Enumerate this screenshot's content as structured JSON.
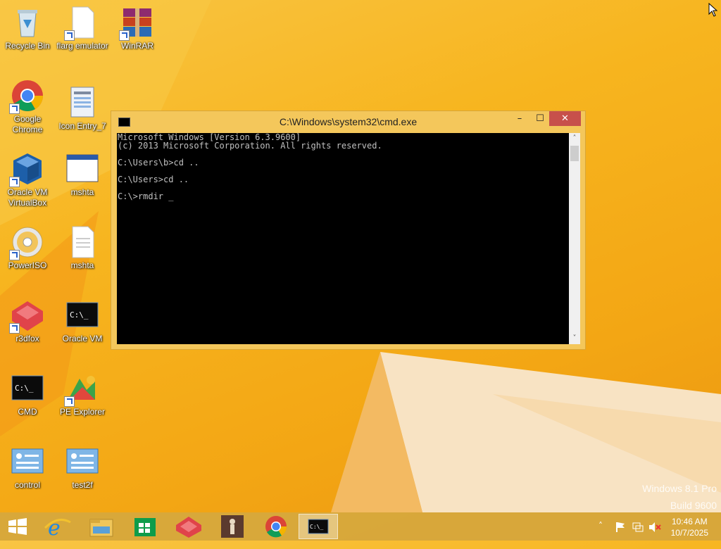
{
  "desktop": {
    "icons": [
      {
        "label": "Recycle Bin"
      },
      {
        "label": "flarg emulator"
      },
      {
        "label": "WinRAR"
      },
      {
        "label": "Google Chrome"
      },
      {
        "label": "Icon Entry_7"
      },
      {
        "label": "Oracle VM VirtualBox"
      },
      {
        "label": "mshta"
      },
      {
        "label": "PowerISO"
      },
      {
        "label": "mshta"
      },
      {
        "label": "r3dfox"
      },
      {
        "label": "Oracle VM"
      },
      {
        "label": "CMD"
      },
      {
        "label": "PE Explorer"
      },
      {
        "label": "control"
      },
      {
        "label": "test2f"
      }
    ],
    "watermark": {
      "line1": "Windows 8.1 Pro",
      "line2": "Build 9600"
    }
  },
  "cmd_window": {
    "title": "C:\\Windows\\system32\\cmd.exe",
    "min_label": "–",
    "max_label": "☐",
    "close_label": "✕",
    "console_text": "Microsoft Windows [Version 6.3.9600]\n(c) 2013 Microsoft Corporation. All rights reserved.\n\nC:\\Users\\b>cd ..\n\nC:\\Users>cd ..\n\nC:\\>rmdir _",
    "scroll_up": "˄",
    "scroll_down": "˅"
  },
  "taskbar": {
    "items": [
      {
        "name": "start",
        "icon": "windows-logo-icon"
      },
      {
        "name": "internet-explorer",
        "icon": "ie-icon"
      },
      {
        "name": "file-explorer",
        "icon": "folder-icon"
      },
      {
        "name": "store",
        "icon": "store-icon"
      },
      {
        "name": "r3dfox",
        "icon": "r3dfox-icon"
      },
      {
        "name": "app-figure",
        "icon": "figure-icon"
      },
      {
        "name": "chrome",
        "icon": "chrome-icon"
      },
      {
        "name": "cmd",
        "icon": "cmd-icon",
        "active": true
      }
    ],
    "tray": {
      "chevron": "˄"
    },
    "clock": {
      "time": "10:46 AM",
      "date": "10/7/2025"
    }
  },
  "colors": {
    "accent": "#f7b51f",
    "close": "#c7504b",
    "console_bg": "#000000",
    "console_fg": "#c0c0c0"
  }
}
